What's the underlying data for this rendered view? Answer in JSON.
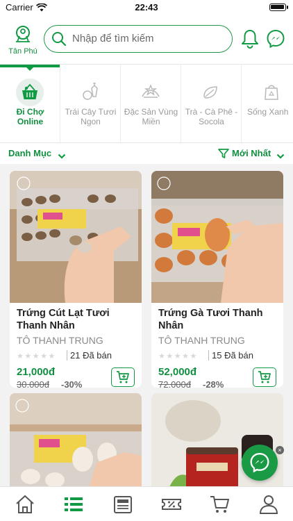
{
  "status_bar": {
    "carrier": "Carrier",
    "time": "22:43"
  },
  "header": {
    "location_label": "Tân Phú",
    "search_placeholder": "Nhập để tìm kiếm"
  },
  "categories": [
    {
      "label": "Đi Chợ Online",
      "active": true,
      "icon": "basket-icon"
    },
    {
      "label": "Trái Cây Tươi Ngon",
      "active": false,
      "icon": "fruit-icon"
    },
    {
      "label": "Đặc Sản Vùng Miền",
      "active": false,
      "icon": "star-badge-icon"
    },
    {
      "label": "Trà - Cà Phê - Socola",
      "active": false,
      "icon": "leaf-icon"
    },
    {
      "label": "Sống Xanh",
      "active": false,
      "icon": "recycle-bag-icon"
    }
  ],
  "sort": {
    "left_label": "Danh Mục",
    "right_label": "Mới Nhất"
  },
  "products": [
    {
      "name": "Trứng Cút Lạt Tươi Thanh Nhân",
      "shop": "TÔ THANH TRUNG",
      "rating": 0,
      "sold": "21 Đã bán",
      "price": "21,000đ",
      "old_price": "30,000đ",
      "discount": "-30%"
    },
    {
      "name": "Trứng Gà Tươi Thanh Nhân",
      "shop": "TÔ THANH TRUNG",
      "rating": 0,
      "sold": "15 Đã bán",
      "price": "52,000đ",
      "old_price": "72,000đ",
      "discount": "-28%"
    }
  ],
  "bottom_nav": [
    {
      "icon": "home-icon",
      "active": false
    },
    {
      "icon": "list-icon",
      "active": true
    },
    {
      "icon": "newspaper-icon",
      "active": false
    },
    {
      "icon": "voucher-icon",
      "active": false
    },
    {
      "icon": "cart-icon",
      "active": false
    },
    {
      "icon": "user-icon",
      "active": false
    }
  ],
  "colors": {
    "brand": "#119a44",
    "text": "#222222",
    "muted": "#9a9a9a"
  }
}
